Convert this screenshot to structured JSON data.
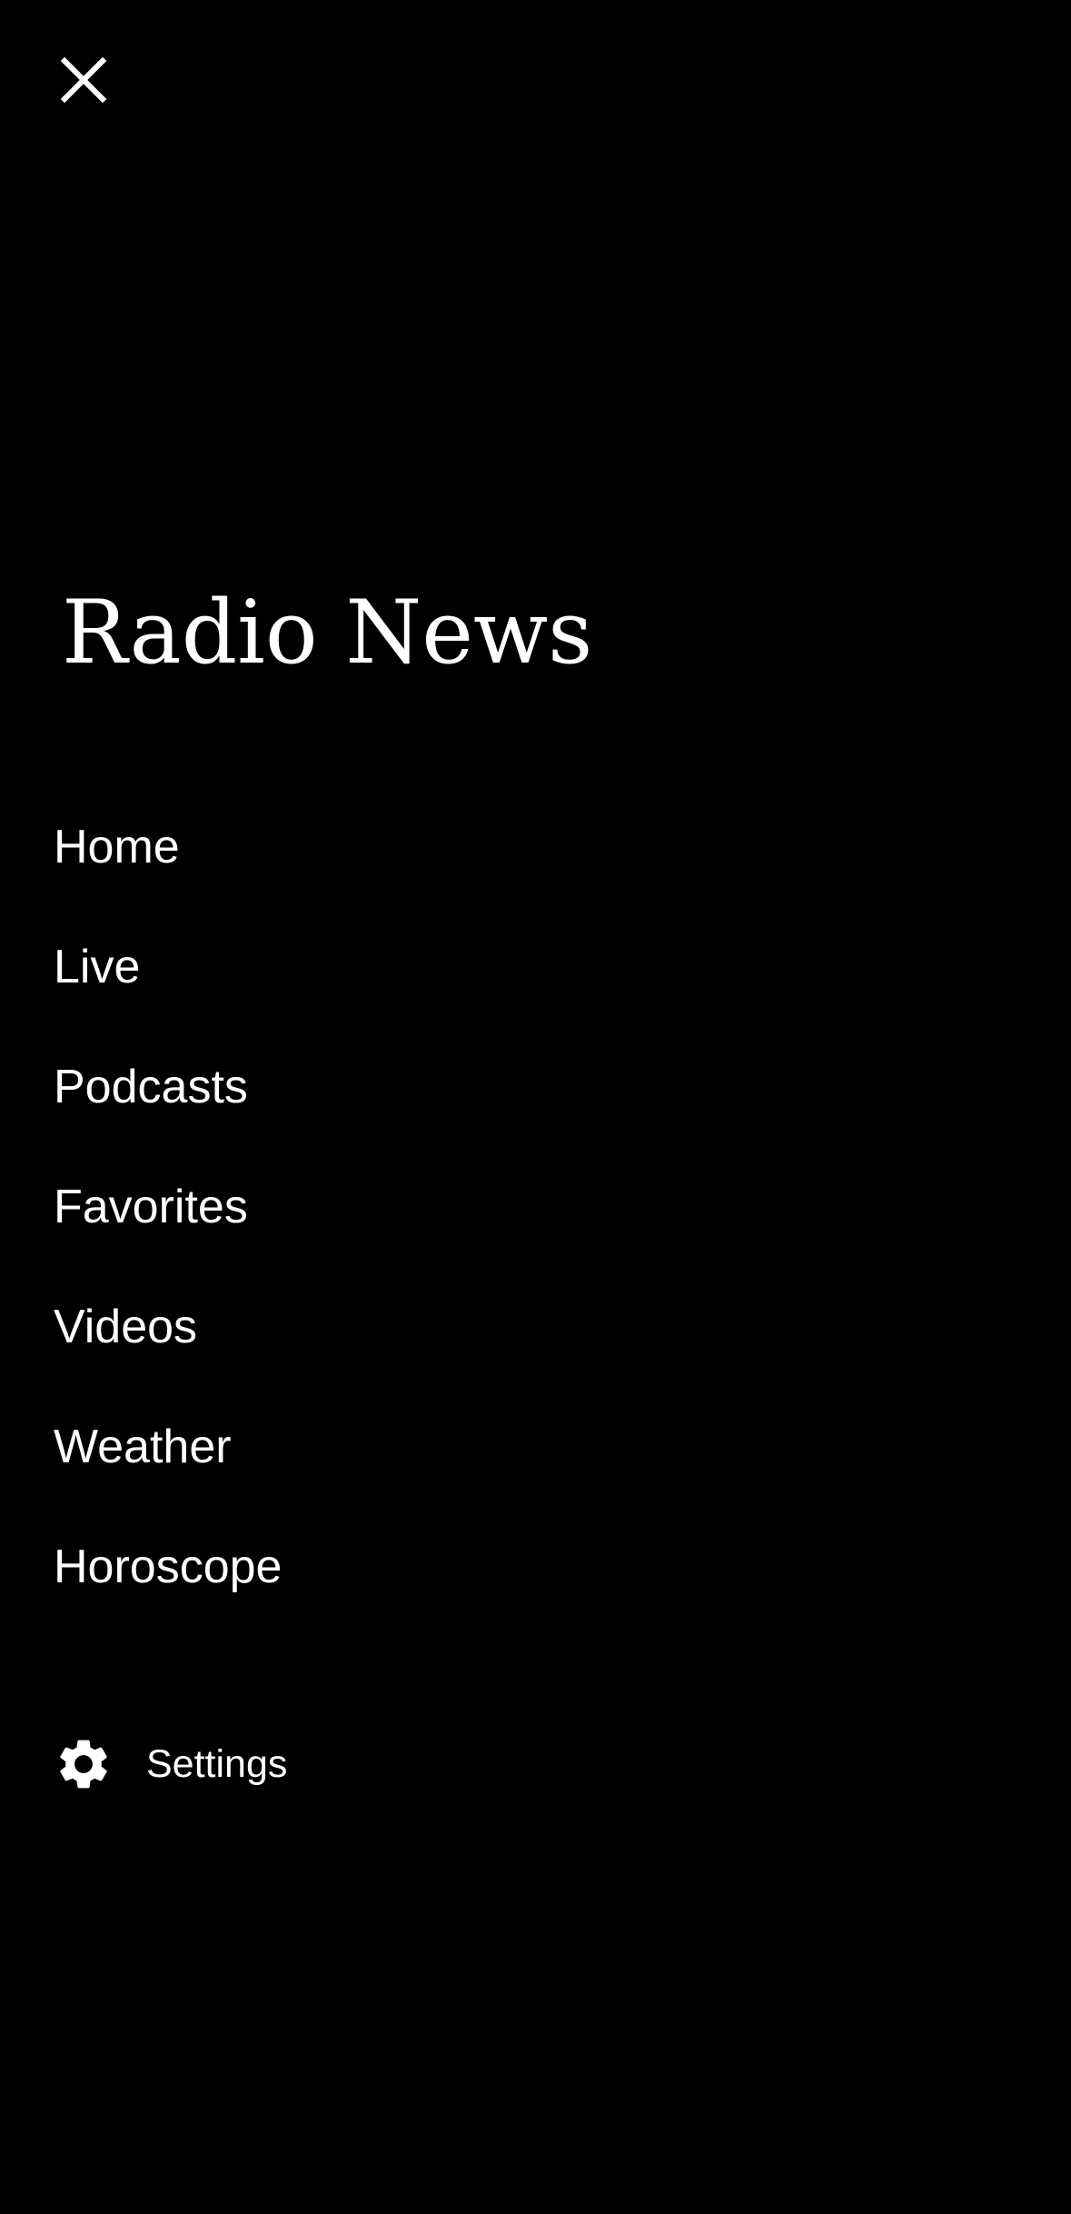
{
  "header": {
    "close_icon": "close-icon",
    "title": "Radio News"
  },
  "menu": {
    "items": [
      {
        "label": "Home"
      },
      {
        "label": "Live"
      },
      {
        "label": "Podcasts"
      },
      {
        "label": "Favorites"
      },
      {
        "label": "Videos"
      },
      {
        "label": "Weather"
      },
      {
        "label": "Horoscope"
      }
    ]
  },
  "settings": {
    "icon": "gear-icon",
    "label": "Settings"
  },
  "colors": {
    "background": "#000000",
    "text": "#ffffff"
  }
}
